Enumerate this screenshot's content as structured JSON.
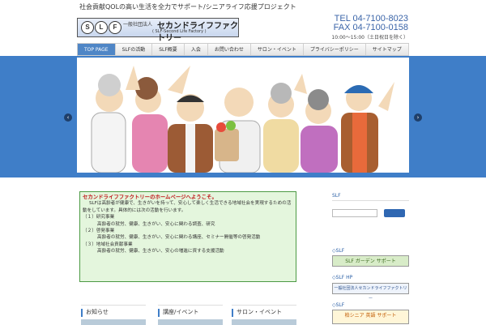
{
  "topline": "社会貢献QOLの高い生活を全力でサポート/シニアライフ応援プロジェクト",
  "logo": {
    "letters": [
      "S",
      "L",
      "F"
    ],
    "org": "一般社団法人",
    "name": "セカンドライフファクトリー",
    "sub": "( SLF-Second Life Factory )"
  },
  "contact": {
    "tel": "TEL 04-7100-8023",
    "fax": "FAX 04-7100-0158",
    "hours": "10:00～15:00（土日祝日を除く）"
  },
  "nav": [
    "TOP PAGE",
    "SLFの活動",
    "SLF概要",
    "入会",
    "お問い合わせ",
    "サロン・イベント",
    "プライバシーポリシー",
    "サイトマップ"
  ],
  "slider": {
    "prev": "‹",
    "next": "›"
  },
  "welcome": {
    "title": "セカンドライフファクトリーのホームページへようこそ。",
    "intro": "SLFは高齢者が健康で、生きがいを持って、安心して楽しく生活できる地域社会を実現するための活動をしています。具体的には次の活動を行います。",
    "items": [
      {
        "head": "（１）研究事業",
        "body": "高齢者の就労、健康、生きがい、安心に関わる調査、研究"
      },
      {
        "head": "（２）啓発事業",
        "body": "高齢者の就労、健康、生きがい、安心に関わる講座、セミナー開催等の啓発活動"
      },
      {
        "head": "（３）地域社会貢献事業",
        "body": "高齢者の就労、健康、生きがい、安心の増進に資する支援活動"
      }
    ]
  },
  "bottom_boxes": [
    "お知らせ",
    "講座/イベント",
    "サロン・イベント"
  ],
  "sidebar": {
    "link": "SLF",
    "labels": [
      "◇SLF",
      "◇SLF HP",
      "◇SLF"
    ],
    "banners": [
      "SLF ガーデン サポート",
      "一般社団法人セカンドライフファクトリー",
      "柏シニア 英語 サポート"
    ]
  },
  "colors": {
    "accent": "#3f7ec8",
    "welcome_bg": "#e4f6dd",
    "welcome_title": "#c0181b"
  }
}
